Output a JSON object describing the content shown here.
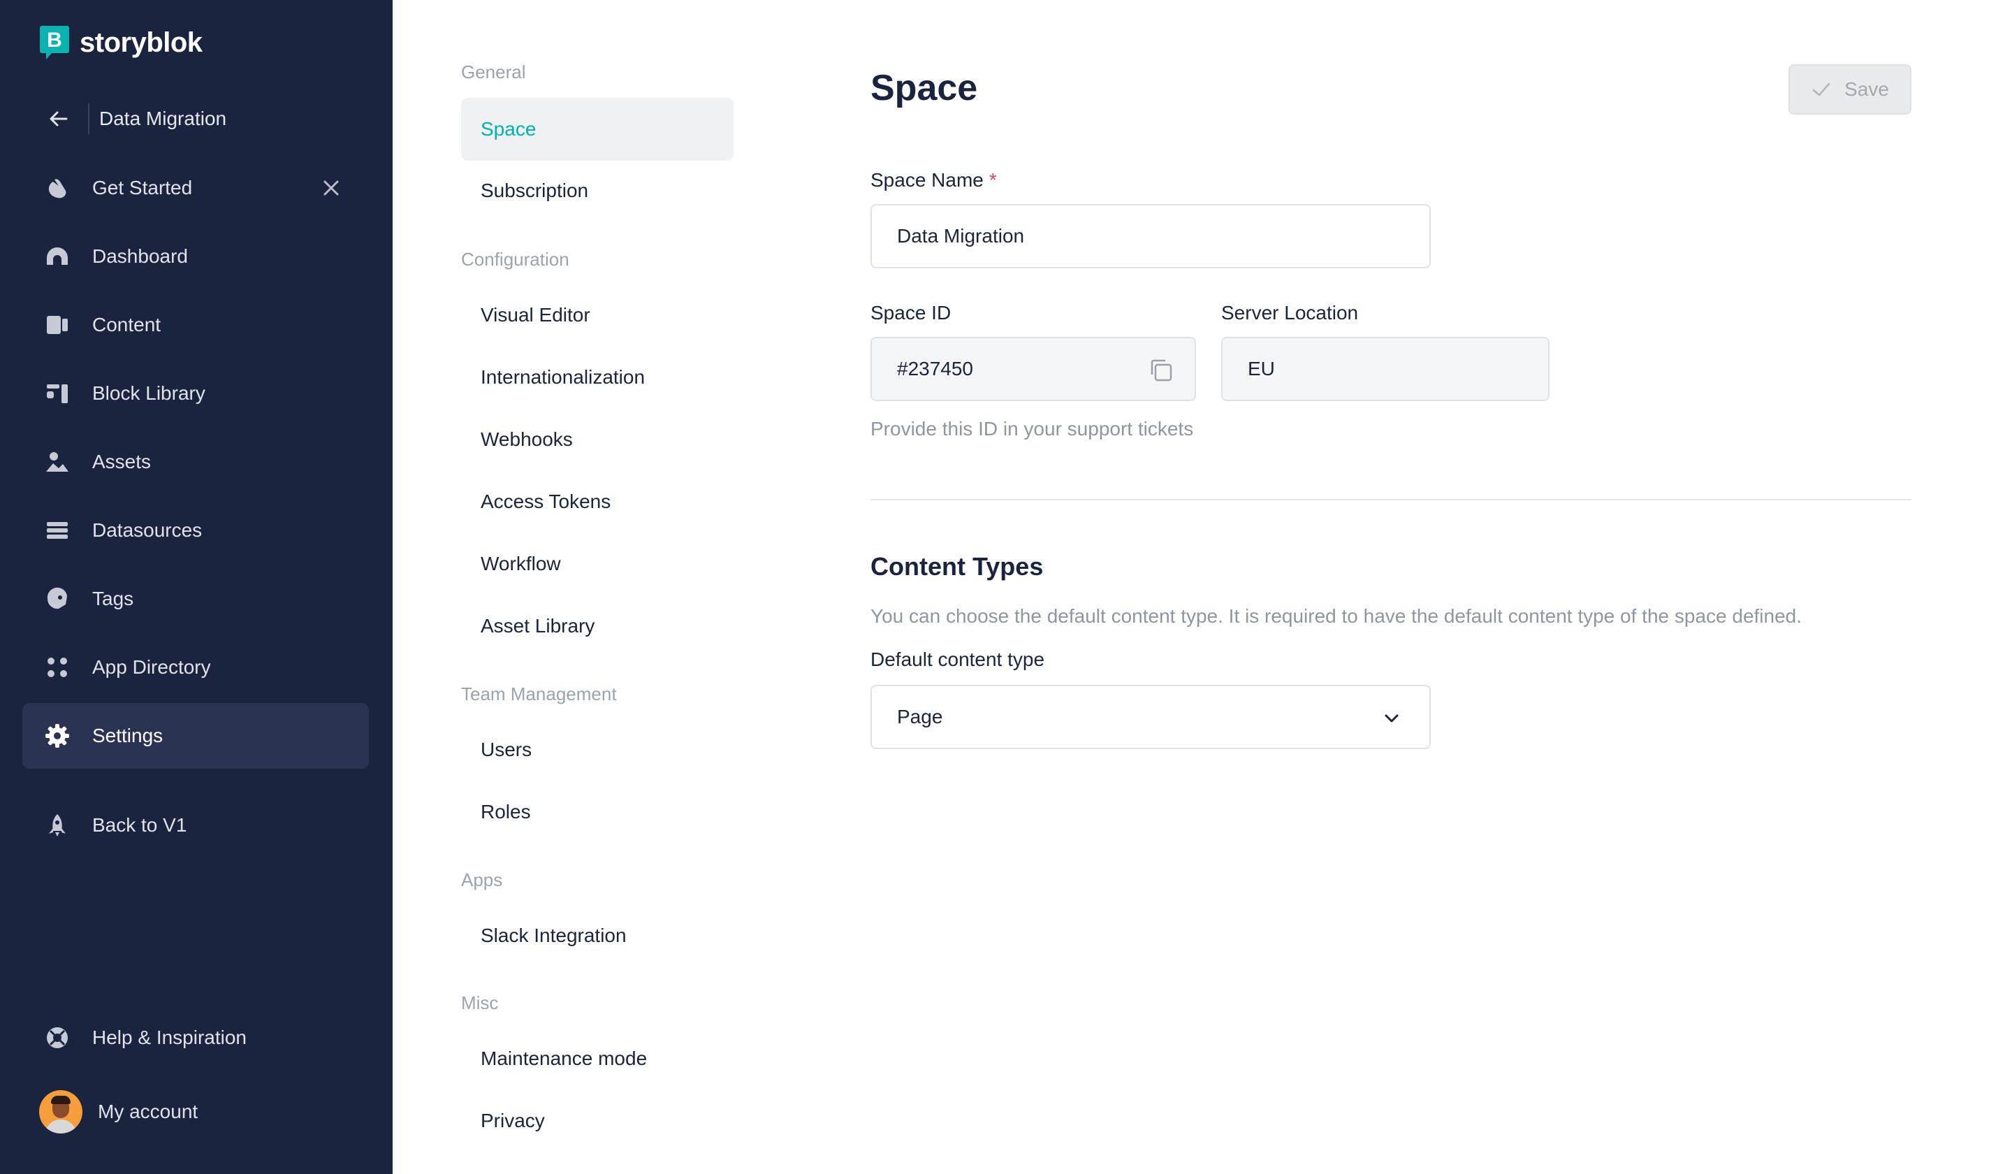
{
  "brand": {
    "name": "storyblok",
    "logo_letter": "B",
    "accent": "#00b3b0"
  },
  "sidebar": {
    "space_name": "Data Migration",
    "items": [
      {
        "label": "Get Started",
        "icon": "hand-wave-icon"
      },
      {
        "label": "Dashboard",
        "icon": "dashboard-gauge-icon"
      },
      {
        "label": "Content",
        "icon": "content-icon"
      },
      {
        "label": "Block Library",
        "icon": "blocks-icon"
      },
      {
        "label": "Assets",
        "icon": "image-icon"
      },
      {
        "label": "Datasources",
        "icon": "datasources-icon"
      },
      {
        "label": "Tags",
        "icon": "tag-icon"
      },
      {
        "label": "App Directory",
        "icon": "apps-grid-icon"
      },
      {
        "label": "Settings",
        "icon": "gear-icon",
        "active": true
      },
      {
        "label": "Back to V1",
        "icon": "rocket-icon"
      }
    ],
    "help_label": "Help & Inspiration",
    "account_label": "My account"
  },
  "subnav": {
    "sections": [
      {
        "title": "General",
        "items": [
          "Space",
          "Subscription"
        ]
      },
      {
        "title": "Configuration",
        "items": [
          "Visual Editor",
          "Internationalization",
          "Webhooks",
          "Access Tokens",
          "Workflow",
          "Asset Library"
        ]
      },
      {
        "title": "Team Management",
        "items": [
          "Users",
          "Roles"
        ]
      },
      {
        "title": "Apps",
        "items": [
          "Slack Integration"
        ]
      },
      {
        "title": "Misc",
        "items": [
          "Maintenance mode",
          "Privacy"
        ]
      }
    ],
    "active": "Space"
  },
  "main": {
    "title": "Space",
    "save_label": "Save",
    "space_name": {
      "label": "Space Name",
      "required_mark": "*",
      "value": "Data Migration"
    },
    "space_id": {
      "label": "Space ID",
      "value": "#237450",
      "hint": "Provide this ID in your support tickets"
    },
    "server_location": {
      "label": "Server Location",
      "value": "EU"
    },
    "content_types": {
      "title": "Content Types",
      "description": "You can choose the default content type. It is required to have the default content type of the space defined.",
      "default_label": "Default content type",
      "default_value": "Page"
    }
  }
}
